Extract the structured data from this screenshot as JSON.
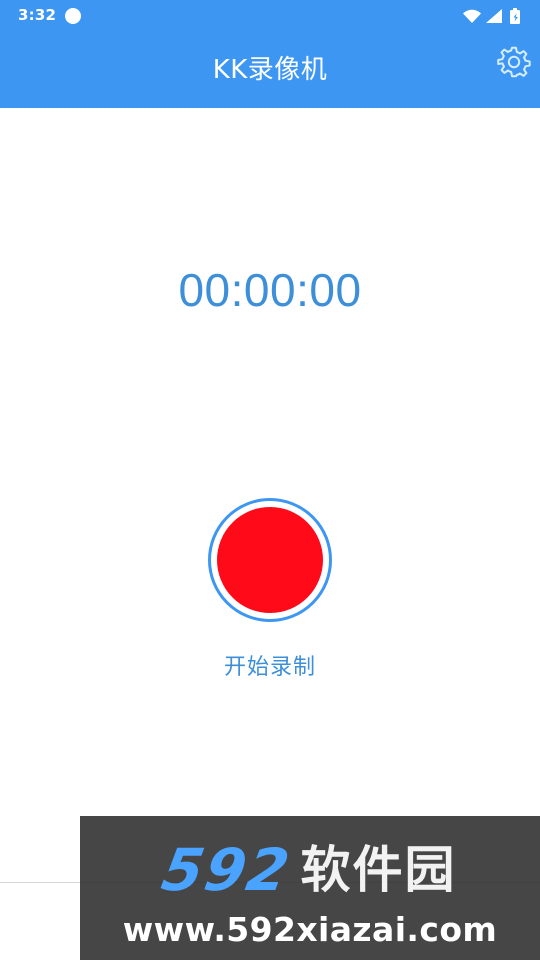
{
  "status_bar": {
    "time": "3:32",
    "icons": [
      "circle-icon",
      "wifi-icon",
      "signal-icon",
      "battery-icon"
    ]
  },
  "app_bar": {
    "title": "KK录像机",
    "settings_icon": "gear-icon"
  },
  "main": {
    "timer": "00:00:00",
    "record_button_label": "开始录制"
  },
  "colors": {
    "primary": "#3d97f2",
    "timer_text": "#3d8fd9",
    "record_red": "#ff0a19",
    "white": "#ffffff"
  },
  "watermark": {
    "digits": "592",
    "chinese": "软件园",
    "url": "www.592xiazai.com"
  }
}
